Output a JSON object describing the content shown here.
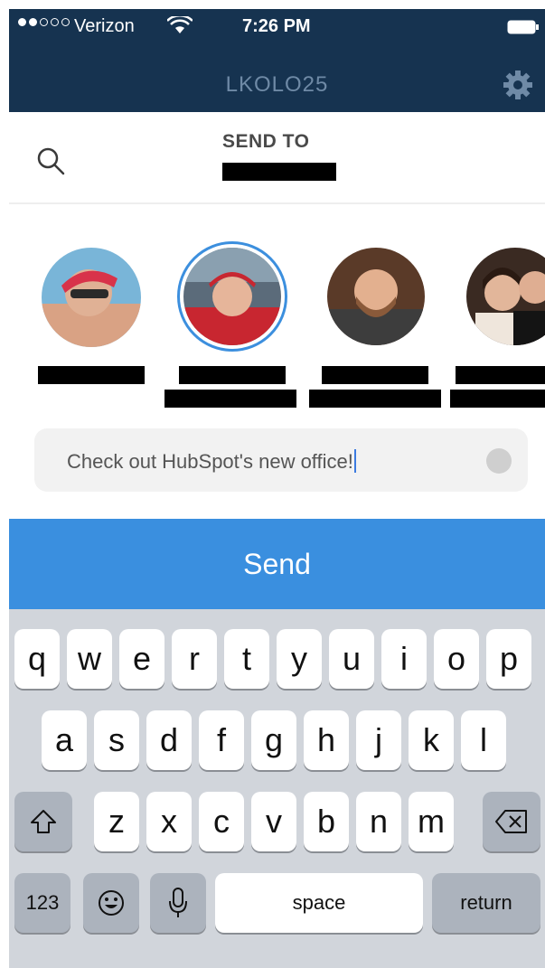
{
  "status_bar": {
    "signal_dots_filled": 2,
    "signal_dots_total": 5,
    "carrier": "Verizon",
    "time": "7:26 PM"
  },
  "header": {
    "title": "LKOLO25",
    "settings_icon": "gear-icon",
    "color": "#163350"
  },
  "send_to": {
    "search_icon": "search-icon",
    "label": "SEND TO"
  },
  "contacts": [
    {
      "selected": false
    },
    {
      "selected": true
    },
    {
      "selected": false
    },
    {
      "selected": false
    }
  ],
  "message": {
    "value": "Check out HubSpot's new office!"
  },
  "send_button": {
    "label": "Send",
    "color": "#3a8fdf"
  },
  "keyboard": {
    "row1": [
      "q",
      "w",
      "e",
      "r",
      "t",
      "y",
      "u",
      "i",
      "o",
      "p"
    ],
    "row2": [
      "a",
      "s",
      "d",
      "f",
      "g",
      "h",
      "j",
      "k",
      "l"
    ],
    "row3": [
      "z",
      "x",
      "c",
      "v",
      "b",
      "n",
      "m"
    ],
    "numbers_key": "123",
    "space_key": "space",
    "return_key": "return",
    "icons": [
      "shift-icon",
      "delete-icon",
      "emoji-icon",
      "microphone-icon"
    ]
  }
}
